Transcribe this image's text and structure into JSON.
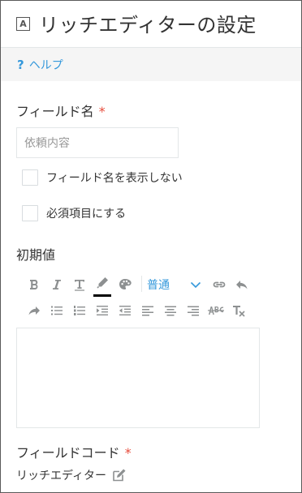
{
  "header": {
    "field_type_icon": "text-field-icon",
    "field_type_glyph": "A",
    "title": "リッチエディターの設定"
  },
  "help": {
    "icon": "question-icon",
    "icon_glyph": "?",
    "label": "ヘルプ"
  },
  "field_name": {
    "label": "フィールド名",
    "required_mark": "*",
    "placeholder": "依頼内容",
    "value": ""
  },
  "options": {
    "hide_label": {
      "label": "フィールド名を表示しない",
      "checked": false
    },
    "required": {
      "label": "必須項目にする",
      "checked": false
    }
  },
  "default_value": {
    "label": "初期値",
    "toolbar": {
      "font_size_selected": "普通",
      "buttons": [
        "bold-icon",
        "italic-icon",
        "underline-icon",
        "text-color-icon",
        "background-color-icon",
        "font-size-select",
        "link-icon",
        "undo-icon",
        "redo-icon",
        "bullet-list-icon",
        "numbered-list-icon",
        "indent-icon",
        "outdent-icon",
        "align-left-icon",
        "align-center-icon",
        "align-right-icon",
        "strikethrough-icon",
        "clear-format-icon"
      ],
      "current_text_color": "#000000"
    },
    "content": ""
  },
  "field_code": {
    "label": "フィールドコード",
    "required_mark": "*",
    "value": "リッチエディター",
    "edit_icon": "pencil-edit-icon"
  },
  "colors": {
    "accent": "#3498db",
    "required": "#e74c3c",
    "icon_gray": "#8d9091",
    "border": "#e3e7e8",
    "help_bar_bg": "#f5f5f5"
  }
}
